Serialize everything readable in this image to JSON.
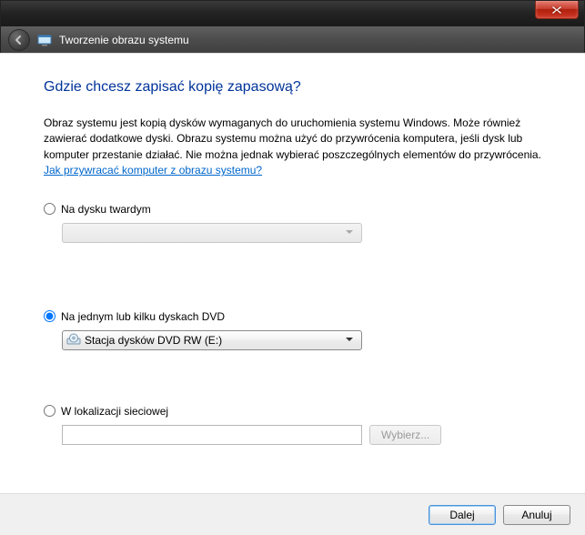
{
  "window": {
    "title": "Tworzenie obrazu systemu"
  },
  "heading": "Gdzie chcesz zapisać kopię zapasową?",
  "description": {
    "text": "Obraz systemu jest kopią dysków wymaganych do uruchomienia systemu Windows. Może również zawierać dodatkowe dyski. Obrazu systemu można użyć do przywrócenia komputera, jeśli dysk lub komputer przestanie działać. Nie można jednak wybierać poszczególnych elementów do przywrócenia.  ",
    "link": "Jak przywracać komputer z obrazu systemu?"
  },
  "options": {
    "hdd": {
      "label": "Na dysku twardym",
      "selected": false,
      "combo_value": ""
    },
    "dvd": {
      "label": "Na jednym lub kilku dyskach DVD",
      "selected": true,
      "combo_value": "Stacja dysków DVD RW (E:)"
    },
    "network": {
      "label": "W lokalizacji sieciowej",
      "selected": false,
      "path_value": "",
      "browse_label": "Wybierz..."
    }
  },
  "footer": {
    "next": "Dalej",
    "cancel": "Anuluj"
  }
}
